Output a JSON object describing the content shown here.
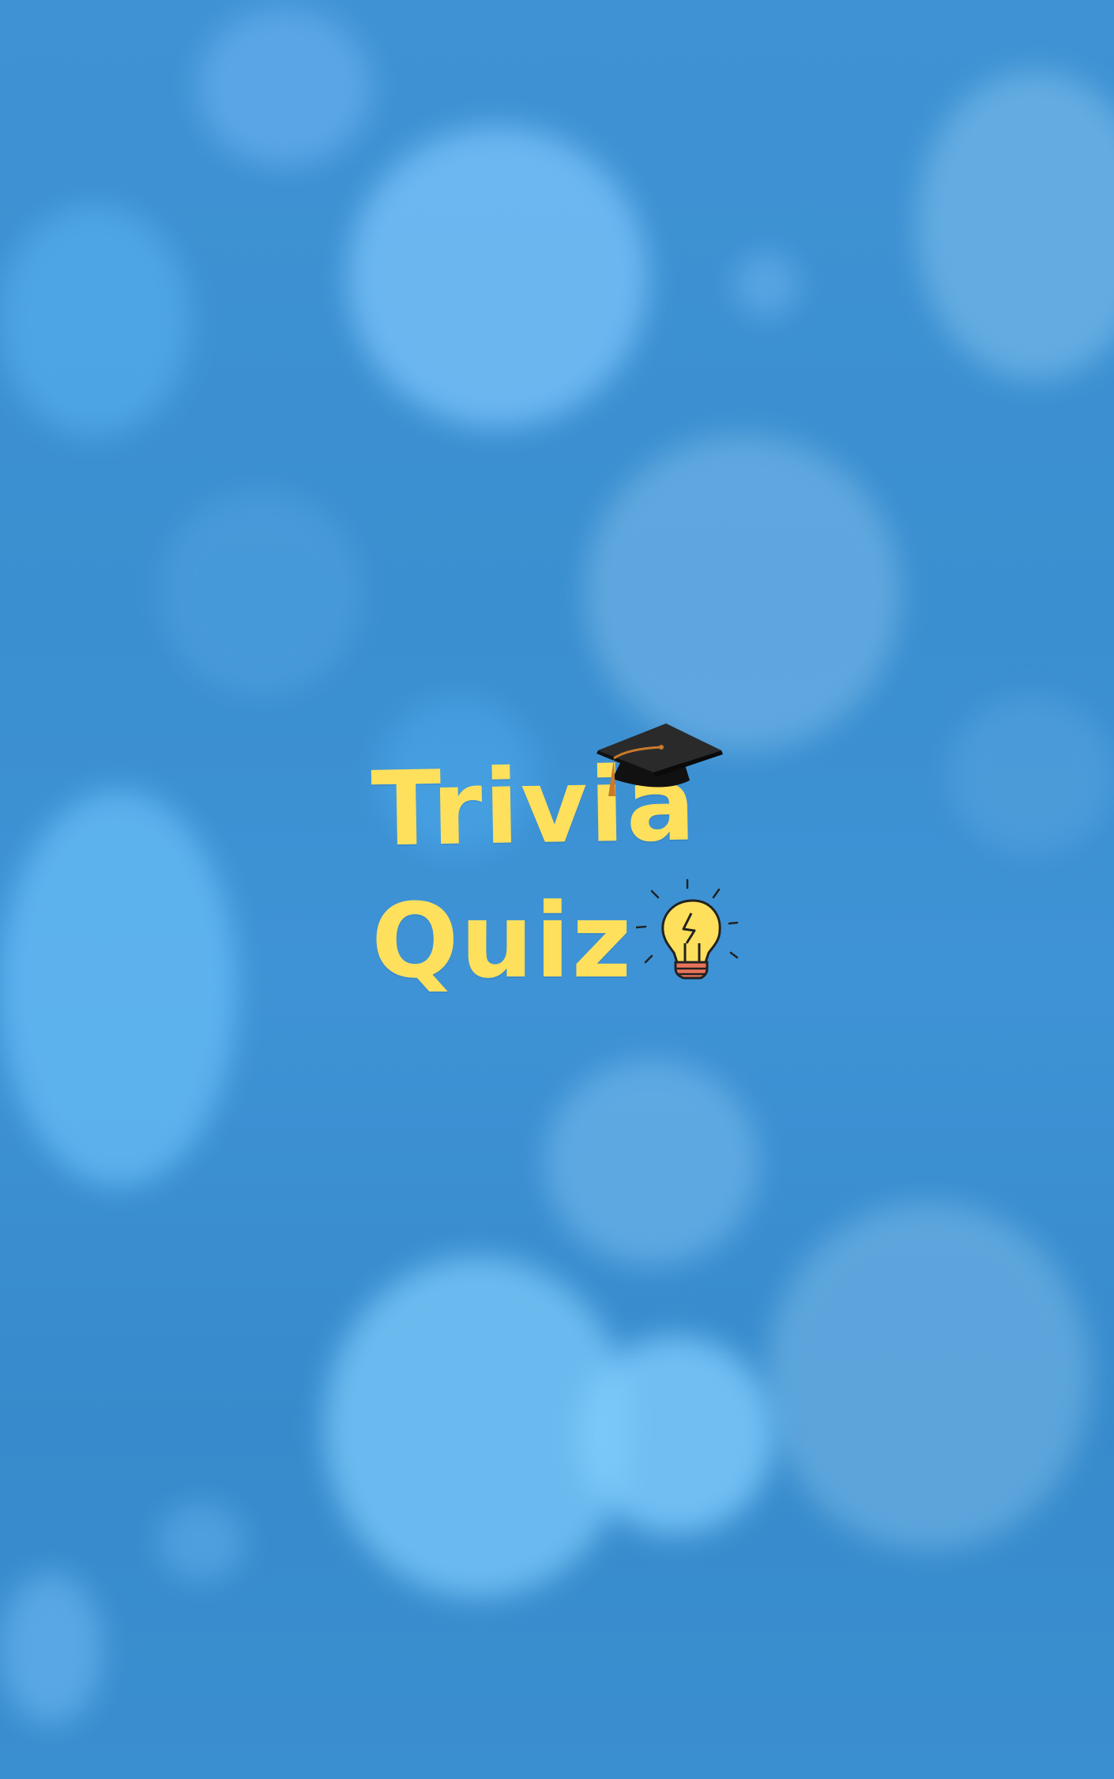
{
  "splash": {
    "title_line1": "Trivia",
    "title_line2": "Quiz"
  },
  "icons": {
    "cap": "graduation-cap-icon",
    "bulb": "lightbulb-icon"
  },
  "colors": {
    "background": "#3a8fd0",
    "title": "#ffe05c",
    "bulb_fill": "#ffe05c",
    "bulb_base": "#e8735a",
    "cap": "#1e1e1e",
    "tassel": "#c97a2c"
  }
}
